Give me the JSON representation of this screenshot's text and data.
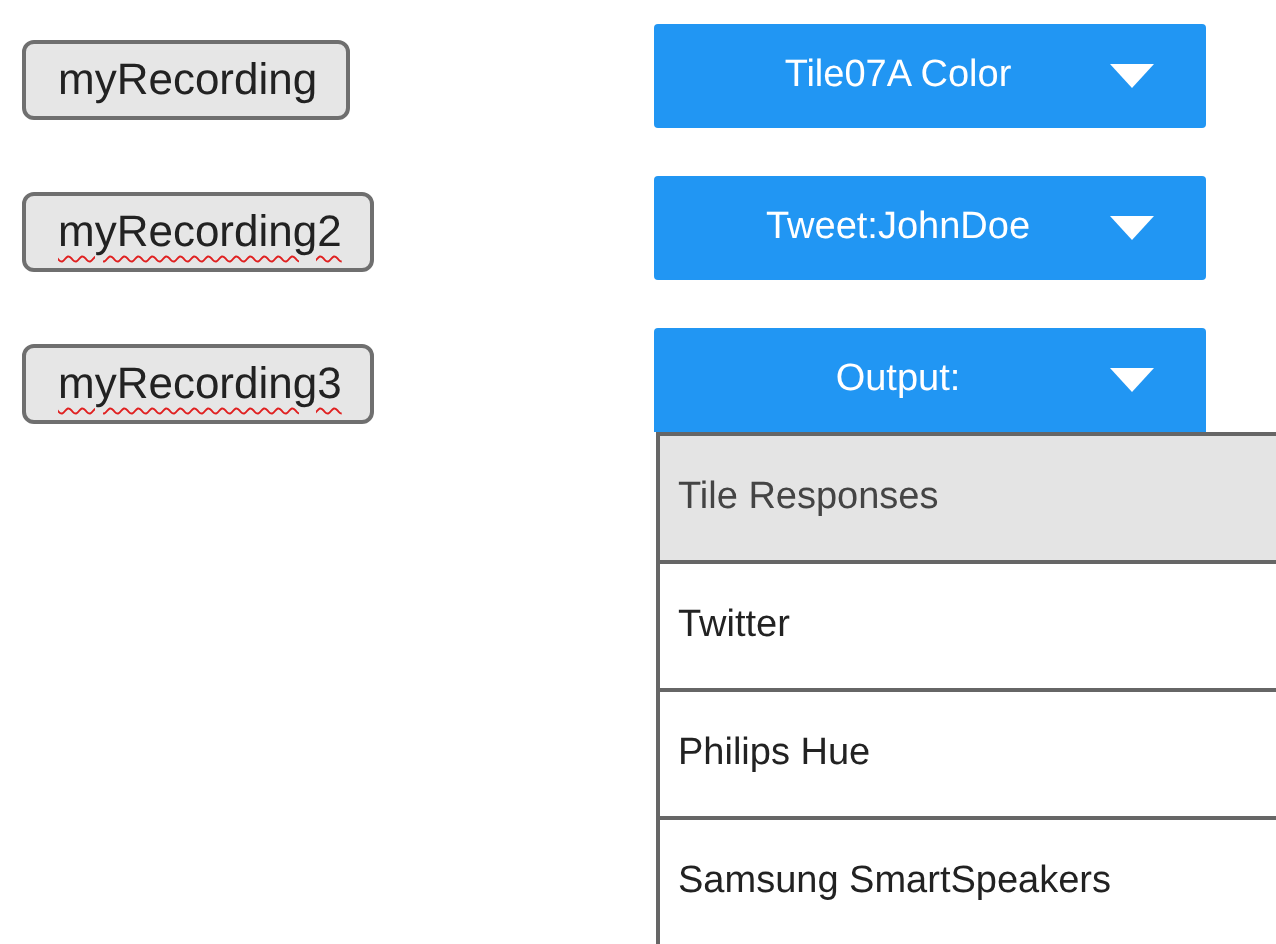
{
  "recordings": [
    {
      "label": "myRecording",
      "misspelled": false
    },
    {
      "label": "myRecording2",
      "misspelled": true
    },
    {
      "label": "myRecording3",
      "misspelled": true
    }
  ],
  "dropdowns": [
    {
      "label": "Tile07A Color",
      "expanded": false
    },
    {
      "label": "Tweet:JohnDoe",
      "expanded": false
    },
    {
      "label": "Output:",
      "expanded": true
    }
  ],
  "menu": {
    "items": [
      {
        "label": "Tile Responses",
        "selected": true
      },
      {
        "label": "Twitter",
        "selected": false
      },
      {
        "label": "Philips Hue",
        "selected": false
      },
      {
        "label": "Samsung SmartSpeakers",
        "selected": false
      }
    ]
  }
}
